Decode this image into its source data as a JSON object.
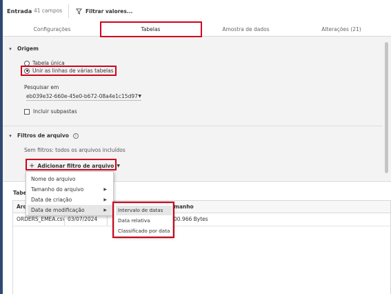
{
  "toolbar": {
    "title": "Entrada",
    "field_count": "41 campos",
    "filter_label": "Filtrar valores..."
  },
  "tabs": [
    {
      "label": "Configurações",
      "active": false
    },
    {
      "label": "Tabelas",
      "active": true
    },
    {
      "label": "Amostra de dados",
      "active": false
    },
    {
      "label": "Alterações (21)",
      "active": false
    }
  ],
  "origin": {
    "heading": "Origem",
    "option_single": "Tabela única",
    "option_union": "Unir as linhas de várias tabelas",
    "selected": "union",
    "search_label": "Pesquisar em",
    "search_value": "eb039e32-660e-45e0-b672-08a4e1c15d97",
    "include_subfolders": "Incluir subpastas",
    "include_subfolders_checked": false
  },
  "file_filters": {
    "heading": "Filtros de arquivo",
    "empty_text": "Sem filtros: todos os arquivos incluídos",
    "add_button": "Adicionar filtro de arquivo"
  },
  "filter_menu": {
    "items": [
      {
        "label": "Nome do arquivo",
        "has_submenu": false
      },
      {
        "label": "Tamanho do arquivo",
        "has_submenu": true
      },
      {
        "label": "Data de criação",
        "has_submenu": true
      },
      {
        "label": "Data de modificação",
        "has_submenu": true
      }
    ],
    "highlighted": "Data de modificação"
  },
  "date_submenu": {
    "items": [
      "Intervalo de datas",
      "Data relativa",
      "Classificado por data"
    ],
    "highlighted": "Intervalo de datas"
  },
  "tables": {
    "title_visible": "Tabe",
    "headers_visible": [
      "Arq",
      "",
      "manho"
    ],
    "rows": [
      [
        "ORDERS_EMEA.csv",
        "03/07/2024",
        "00.966 Bytes"
      ]
    ]
  },
  "colors": {
    "highlight": "#d0021b",
    "sidebar": "#2f4a70",
    "panel": "#f3f3f3"
  },
  "icons": {
    "filter": "funnel-icon",
    "info": "info-icon",
    "plus": "plus-icon",
    "caret": "caret-down-icon",
    "chevron": "chevron-right-icon"
  }
}
